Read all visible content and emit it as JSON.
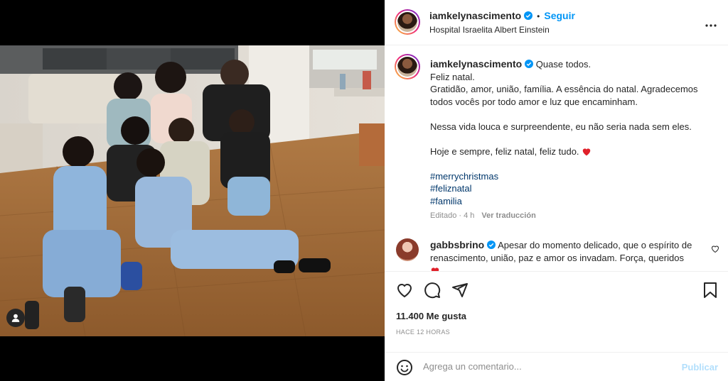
{
  "post": {
    "author": "iamkelynascimento",
    "follow_label": "Seguir",
    "location": "Hospital Israelita Albert Einstein",
    "separator": "•",
    "more_label": "•••"
  },
  "caption": {
    "author": "iamkelynascimento",
    "first_line": "Quase todos.",
    "lines": [
      "Feliz natal.",
      "Gratidão, amor, união, família. A essência do natal. Agradecemos todos vocês por todo amor e luz que encaminham."
    ],
    "para2": "Nessa vida louca e surpreendente, eu não seria nada sem eles.",
    "para3": "Hoje e sempre, feliz natal, feliz tudo.",
    "hashtags": [
      "#merrychristmas",
      "#feliznatal",
      "#familia"
    ],
    "edited": "Editado · 4 h",
    "translate": "Ver traducción"
  },
  "comment": {
    "author": "gabbsbrino",
    "text": "Apesar do momento delicado, que o espírito de renascimento, união, paz e amor os invadam. Força, queridos"
  },
  "stats": {
    "likes": "11.400 Me gusta",
    "time": "HACE 12 HORAS"
  },
  "composer": {
    "placeholder": "Agrega un comentario...",
    "publish": "Publicar"
  },
  "icons": {
    "verified": "verified-badge-icon",
    "like": "heart-icon",
    "comment": "comment-icon",
    "share": "share-icon",
    "save": "bookmark-icon",
    "emoji": "emoji-icon",
    "tag": "user-tag-icon"
  },
  "colors": {
    "accent": "#0095f6",
    "hashtag": "#00376b",
    "muted": "#8e8e8e",
    "publish_disabled": "#b2dffc",
    "heart_red": "#ed4956"
  }
}
